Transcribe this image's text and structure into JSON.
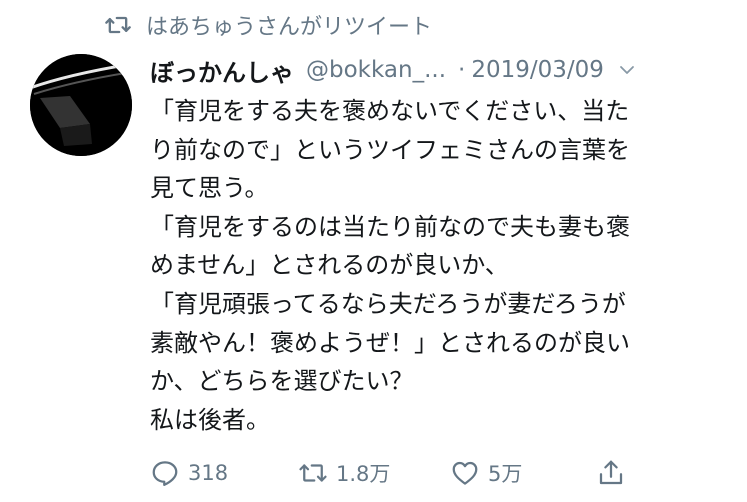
{
  "retweet_context": {
    "icon": "retweet-icon",
    "text": "はあちゅうさんがリツイート"
  },
  "tweet": {
    "author": {
      "display_name": "ぼっかんしゃ",
      "handle": "@bokkan_...",
      "avatar": "avatar-image"
    },
    "separator": "·",
    "date": "2019/03/09",
    "menu_icon": "chevron-down-icon",
    "text_lines": [
      "「育児をする夫を褒めないでください、当た",
      "り前なので」というツイフェミさんの言葉を",
      "見て思う。",
      "「育児をするのは当たり前なので夫も妻も褒",
      "めません」とされるのが良いか、",
      "「育児頑張ってるなら夫だろうが妻だろうが",
      "素敵やん！褒めようぜ！」とされるのが良い",
      "か、どちらを選びたい？",
      "私は後者。"
    ]
  },
  "actions": {
    "reply": {
      "icon": "reply-icon",
      "count": "318"
    },
    "retweet": {
      "icon": "retweet-icon",
      "count": "1.8万"
    },
    "like": {
      "icon": "heart-icon",
      "count": "5万"
    },
    "share": {
      "icon": "share-icon"
    }
  },
  "colors": {
    "text": "#14171a",
    "secondary": "#657786",
    "background": "#ffffff"
  }
}
